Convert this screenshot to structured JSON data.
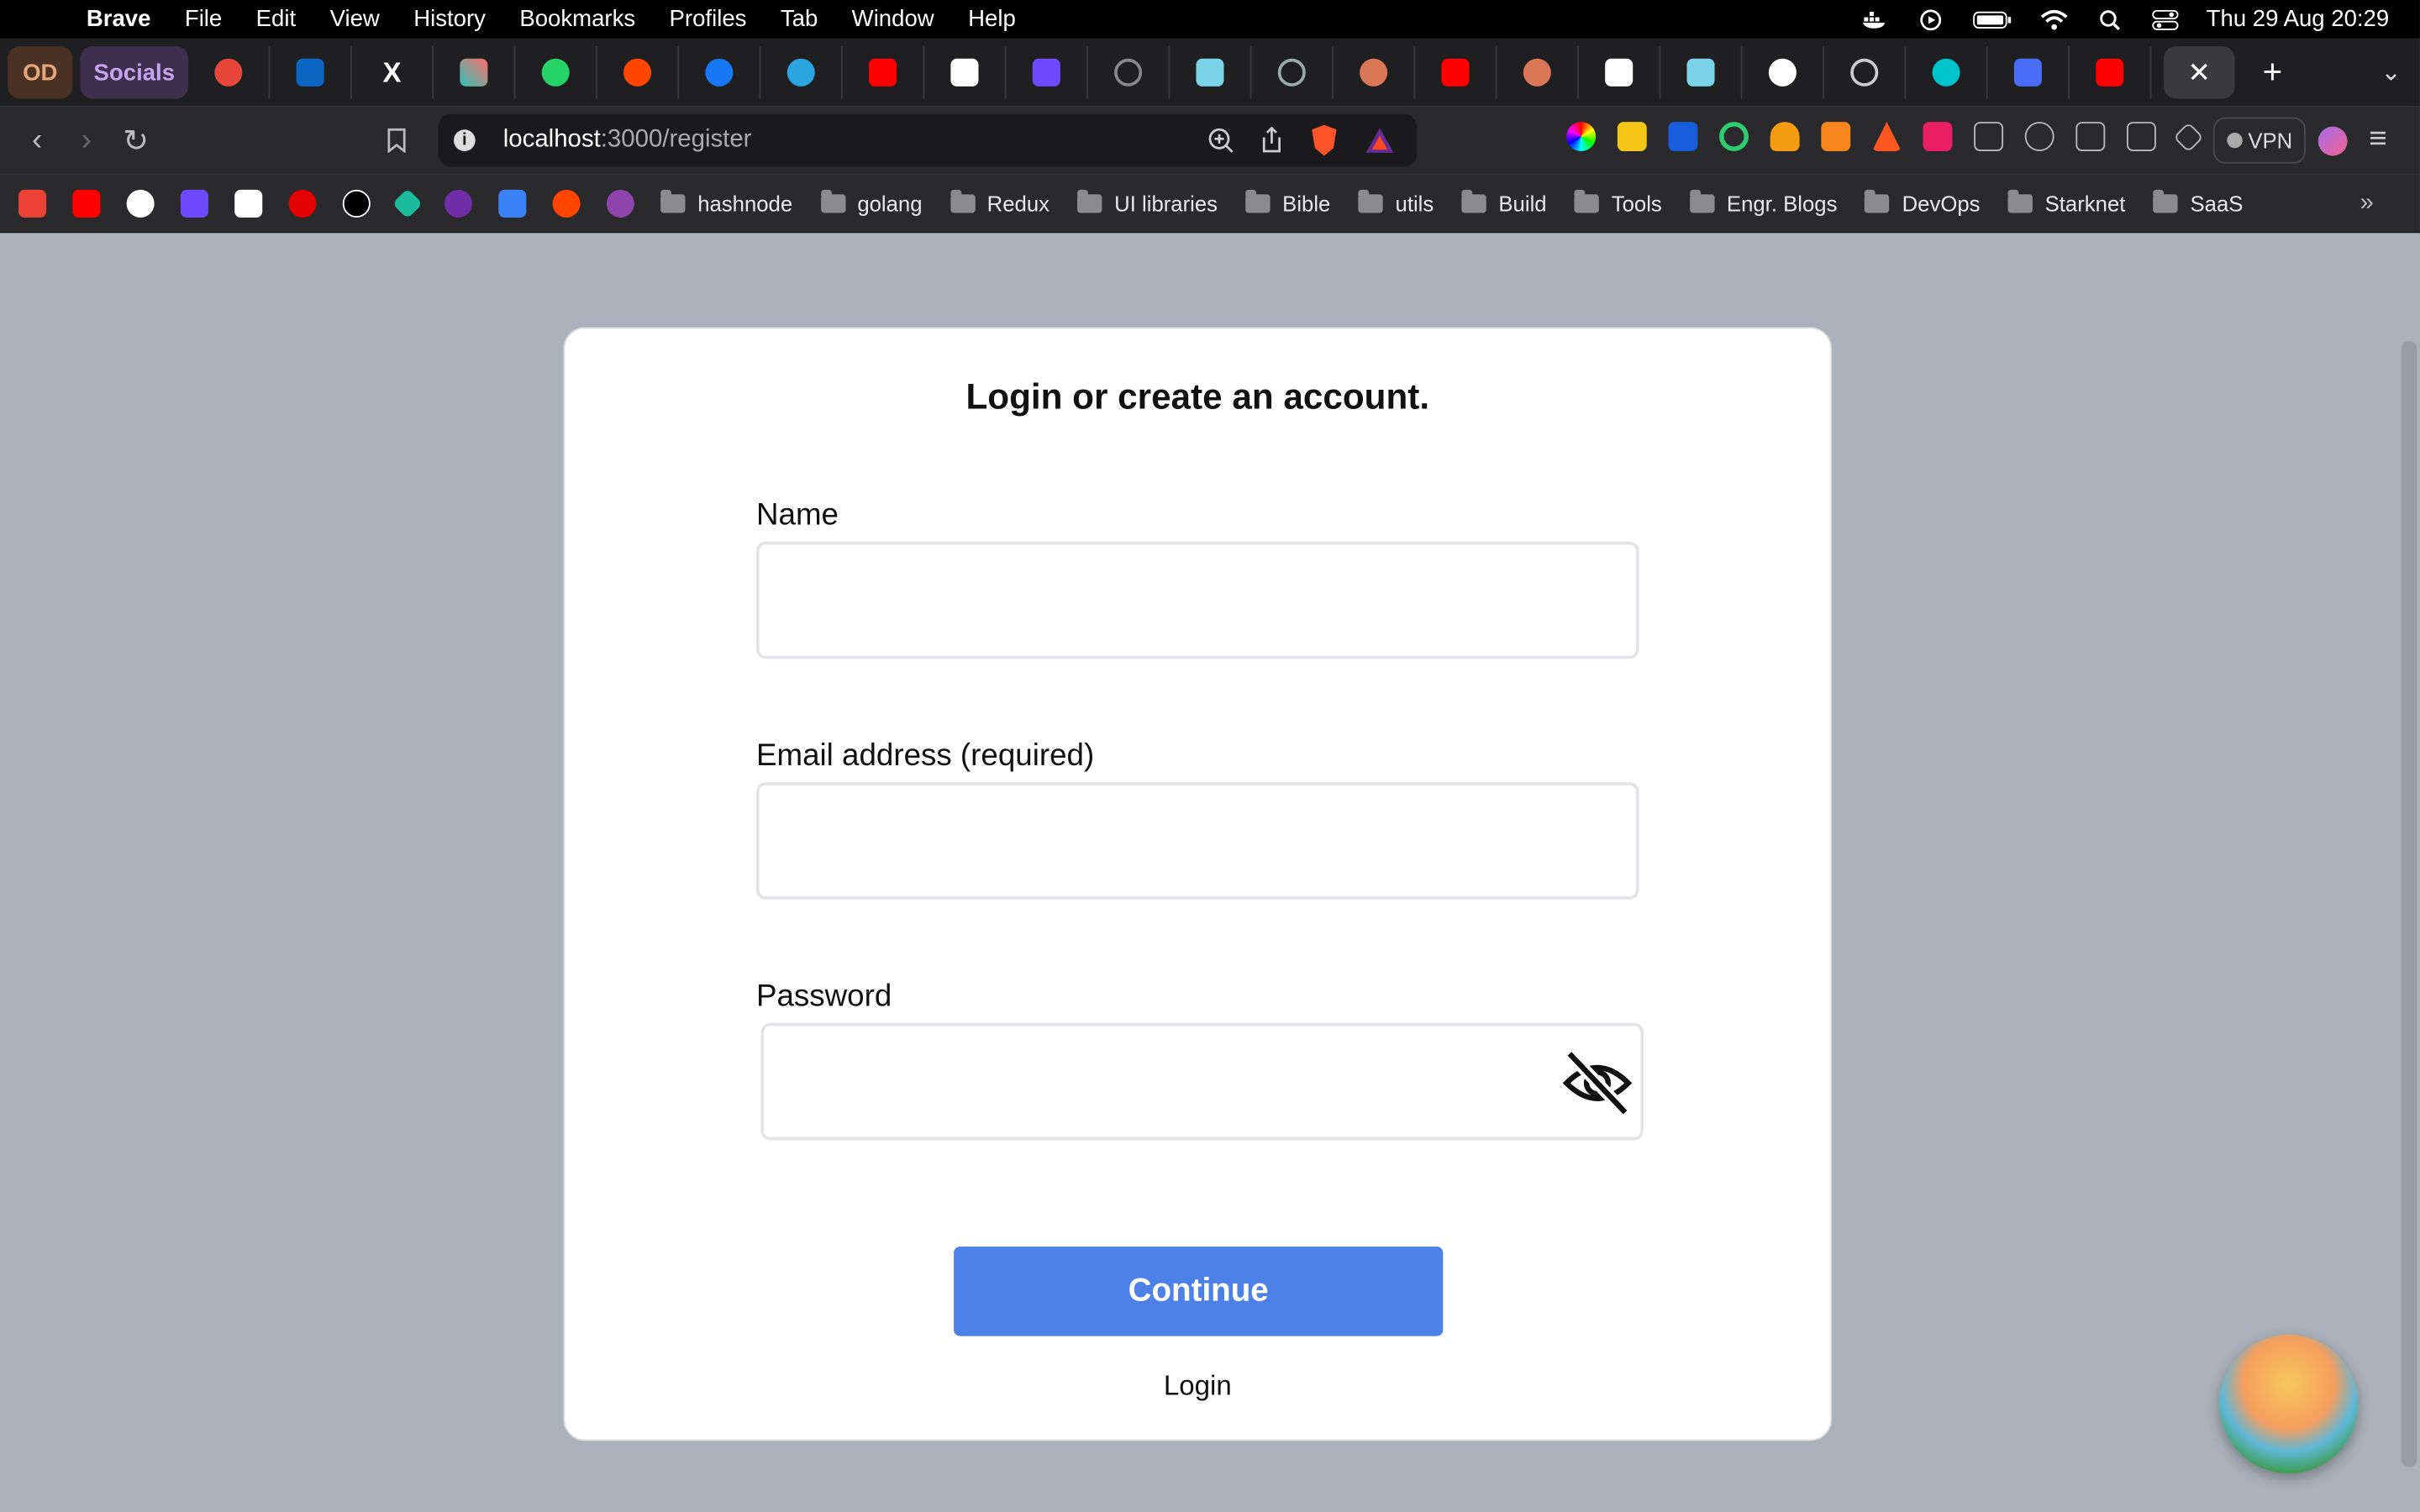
{
  "menubar": {
    "app": "Brave",
    "items": [
      "File",
      "Edit",
      "View",
      "History",
      "Bookmarks",
      "Profiles",
      "Tab",
      "Window",
      "Help"
    ],
    "datetime": "Thu 29 Aug  20:29"
  },
  "tabs": {
    "group1": "OD",
    "group2": "Socials",
    "icons": [
      "reddit-like",
      "linkedin",
      "x",
      "xcode-cloud",
      "whatsapp",
      "reddit",
      "facebook",
      "telegram",
      "youtube",
      "notion",
      "proton-mail",
      "loader",
      "gitbook",
      "gitbook",
      "claude",
      "youtube",
      "claude",
      "sp",
      "gitbook",
      "github",
      "github-dark",
      "canva",
      "video",
      "youtube"
    ],
    "active_close": "✕",
    "new_tab": "+"
  },
  "address": {
    "host": "localhost",
    "path": ":3000/register"
  },
  "vpn_label": "VPN",
  "bookmarks": {
    "folders": [
      "hashnode",
      "golang",
      "Redux",
      "UI libraries",
      "Bible",
      "utils",
      "Build",
      "Tools",
      "Engr. Blogs",
      "DevOps",
      "Starknet",
      "SaaS"
    ],
    "more": "»"
  },
  "form": {
    "title": "Login or create an account.",
    "name_label": "Name",
    "name_value": "",
    "email_label": "Email address (required)",
    "email_value": "",
    "password_label": "Password",
    "password_value": "",
    "continue_label": "Continue",
    "login_label": "Login"
  },
  "colors": {
    "accent": "#4e81e8",
    "page_bg": "#aab1ba"
  }
}
